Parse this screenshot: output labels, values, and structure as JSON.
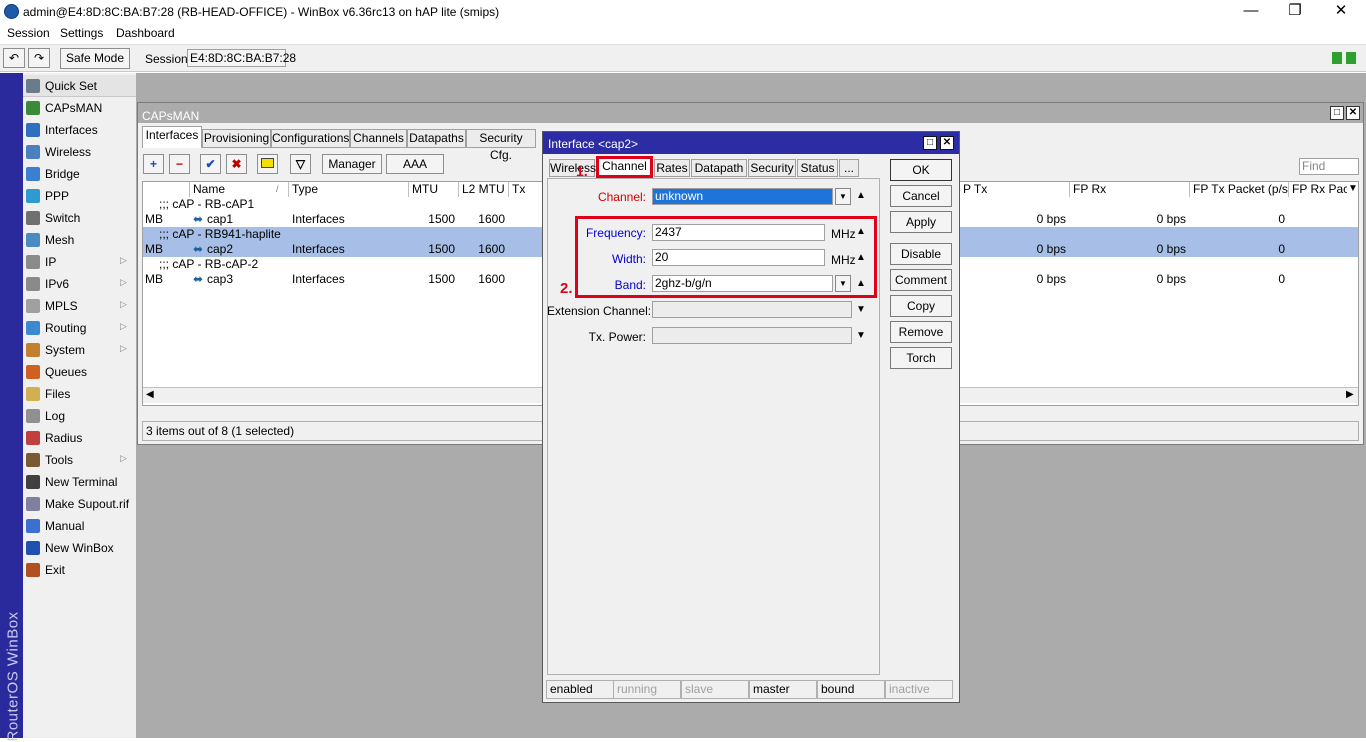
{
  "window": {
    "title": "admin@E4:8D:8C:BA:B7:28 (RB-HEAD-OFFICE) - WinBox v6.36rc13 on hAP lite (smips)",
    "min": "—",
    "max": "❐",
    "close": "✕"
  },
  "menu": [
    "Session",
    "Settings",
    "Dashboard"
  ],
  "toolbar": {
    "undo": "↶",
    "redo": "↷",
    "safe_mode": "Safe Mode",
    "session_label": "Session:",
    "session_value": "E4:8D:8C:BA:B7:28"
  },
  "sidebar_brand": "RouterOS WinBox",
  "sidebar": [
    {
      "label": "Quick Set"
    },
    {
      "label": "CAPsMAN"
    },
    {
      "label": "Interfaces"
    },
    {
      "label": "Wireless"
    },
    {
      "label": "Bridge"
    },
    {
      "label": "PPP"
    },
    {
      "label": "Switch"
    },
    {
      "label": "Mesh"
    },
    {
      "label": "IP",
      "arrow": "▷"
    },
    {
      "label": "IPv6",
      "arrow": "▷"
    },
    {
      "label": "MPLS",
      "arrow": "▷"
    },
    {
      "label": "Routing",
      "arrow": "▷"
    },
    {
      "label": "System",
      "arrow": "▷"
    },
    {
      "label": "Queues"
    },
    {
      "label": "Files"
    },
    {
      "label": "Log"
    },
    {
      "label": "Radius"
    },
    {
      "label": "Tools",
      "arrow": "▷"
    },
    {
      "label": "New Terminal"
    },
    {
      "label": "Make Supout.rif"
    },
    {
      "label": "Manual"
    },
    {
      "label": "New WinBox"
    },
    {
      "label": "Exit"
    }
  ],
  "capsman": {
    "title": "CAPsMAN",
    "tabs": [
      "Interfaces",
      "Provisioning",
      "Configurations",
      "Channels",
      "Datapaths",
      "Security Cfg."
    ],
    "buttons": {
      "add": "+",
      "remove": "−",
      "enable": "✔",
      "disable": "✖",
      "comment": "▭",
      "filter": "▽",
      "manager": "Manager",
      "aaa": "AAA"
    },
    "find_placeholder": "Find",
    "columns": [
      "Name",
      "/",
      "Type",
      "MTU",
      "L2 MTU",
      "Tx",
      "P Tx",
      "FP Rx",
      "FP Tx Packet (p/s)",
      "FP Rx Pack"
    ],
    "rows": [
      {
        "group": ";;; cAP - RB-cAP1"
      },
      {
        "flag": "MB",
        "name": "cap1",
        "type": "Interfaces",
        "mtu": "1500",
        "l2mtu": "1600",
        "fptx": "0 bps",
        "fprx": "0 bps",
        "fptxp": "0"
      },
      {
        "group": ";;; cAP - RB941-haplite",
        "selected": true
      },
      {
        "flag": "MB",
        "name": "cap2",
        "type": "Interfaces",
        "mtu": "1500",
        "l2mtu": "1600",
        "fptx": "0 bps",
        "fprx": "0 bps",
        "fptxp": "0",
        "selected": true
      },
      {
        "group": ";;; cAP - RB-cAP-2"
      },
      {
        "flag": "MB",
        "name": "cap3",
        "type": "Interfaces",
        "mtu": "1500",
        "l2mtu": "1600",
        "fptx": "0 bps",
        "fprx": "0 bps",
        "fptxp": "0"
      }
    ],
    "status": "3 items out of 8 (1 selected)"
  },
  "dialog": {
    "title": "Interface <cap2>",
    "tabs": [
      "Wireless",
      "Channel",
      "Rates",
      "Datapath",
      "Security",
      "Status",
      "..."
    ],
    "channel_label": "Channel:",
    "channel_value": "unknown",
    "frequency_label": "Frequency:",
    "frequency_value": "2437",
    "frequency_unit": "MHz",
    "width_label": "Width:",
    "width_value": "20",
    "width_unit": "MHz",
    "band_label": "Band:",
    "band_value": "2ghz-b/g/n",
    "ext_label": "Extension Channel:",
    "txpower_label": "Tx. Power:",
    "buttons": [
      "OK",
      "Cancel",
      "Apply",
      "Disable",
      "Comment",
      "Copy",
      "Remove",
      "Torch"
    ],
    "status": [
      "enabled",
      "running",
      "slave",
      "master",
      "bound",
      "inactive"
    ],
    "annotation1": "1.",
    "annotation2": "2."
  },
  "colors": {
    "accent": "#2c2ca4",
    "annotation": "#e0001a",
    "selection": "#a7bfe6"
  }
}
